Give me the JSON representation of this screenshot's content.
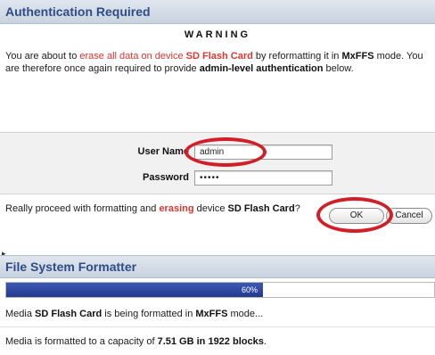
{
  "auth_dialog": {
    "title": "Authentication Required",
    "warning_heading": "WARNING",
    "message": {
      "p1": "You are about to ",
      "p2": "erase all data on device",
      "p3": " ",
      "p4": "SD Flash Card",
      "p5": " by reformatting it in ",
      "p6": "MxFFS",
      "p7": " mode. You are therefore once again required to provide ",
      "p8": "admin-level authentication",
      "p9": " below."
    },
    "user_name_label": "User Name",
    "user_name_value": "admin",
    "password_label": "Password",
    "password_value": "•••••",
    "proceed": {
      "p1": "Really proceed with formatting and ",
      "p2": "erasing",
      "p3": " device ",
      "p4": "SD Flash Card",
      "p5": "?"
    },
    "ok_label": "OK",
    "cancel_label": "Cancel"
  },
  "formatter": {
    "title": "File System Formatter",
    "progress_percent": 60,
    "progress_label": "60%",
    "status1": {
      "p1": "Media ",
      "p2": "SD Flash Card",
      "p3": " is being formatted in ",
      "p4": "MxFFS",
      "p5": " mode..."
    },
    "status2": {
      "p1": "Media is formatted to a capacity of ",
      "p2": "7.51 GB in 1922 blocks",
      "p3": "."
    }
  },
  "colors": {
    "title_blue": "#2e4c86",
    "warning_red": "#d8382f",
    "progress_blue": "#2f46a0",
    "highlight_red": "#d21e26"
  }
}
